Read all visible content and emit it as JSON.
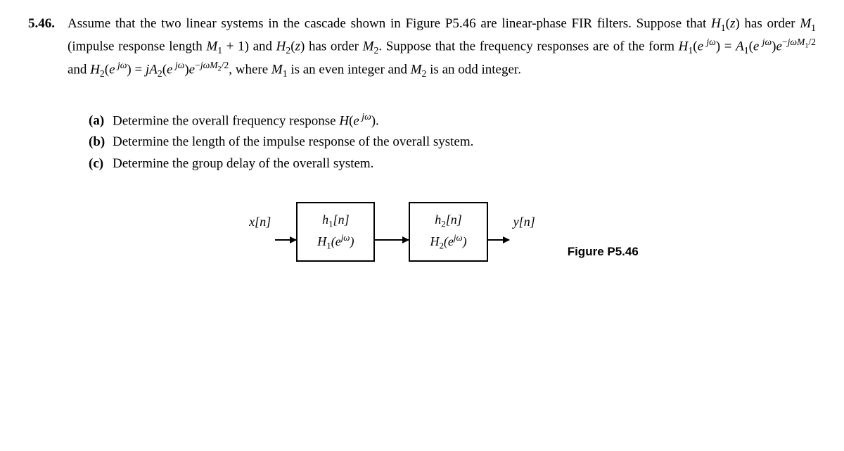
{
  "problem": {
    "number": "5.46.",
    "text": "Assume that the two linear systems in the cascade shown in Figure P5.46 are linear-phase FIR filters. Suppose that H₁(z) has order M₁ (impulse response length M₁ + 1) and H₂(z) has order M₂. Suppose that the frequency responses are of the form H₁(eʲω) = A₁(eʲω)e⁻ʲωM₁/2 and H₂(eʲω) = jA₂(eʲω)e⁻ʲωM₂/2, where M₁ is an even integer and M₂ is an odd integer."
  },
  "subparts": {
    "a": {
      "label": "(a)",
      "text": "Determine the overall frequency response H(eʲω)."
    },
    "b": {
      "label": "(b)",
      "text": "Determine the length of the impulse response of the overall system."
    },
    "c": {
      "label": "(c)",
      "text": "Determine the group delay of the overall system."
    }
  },
  "figure": {
    "input": "x[n]",
    "block1_top": "h₁[n]",
    "block1_bottom": "H₁(ejω)",
    "block2_top": "h₂[n]",
    "block2_bottom": "H₂(ejω)",
    "output": "y[n]",
    "caption": "Figure P5.46"
  }
}
